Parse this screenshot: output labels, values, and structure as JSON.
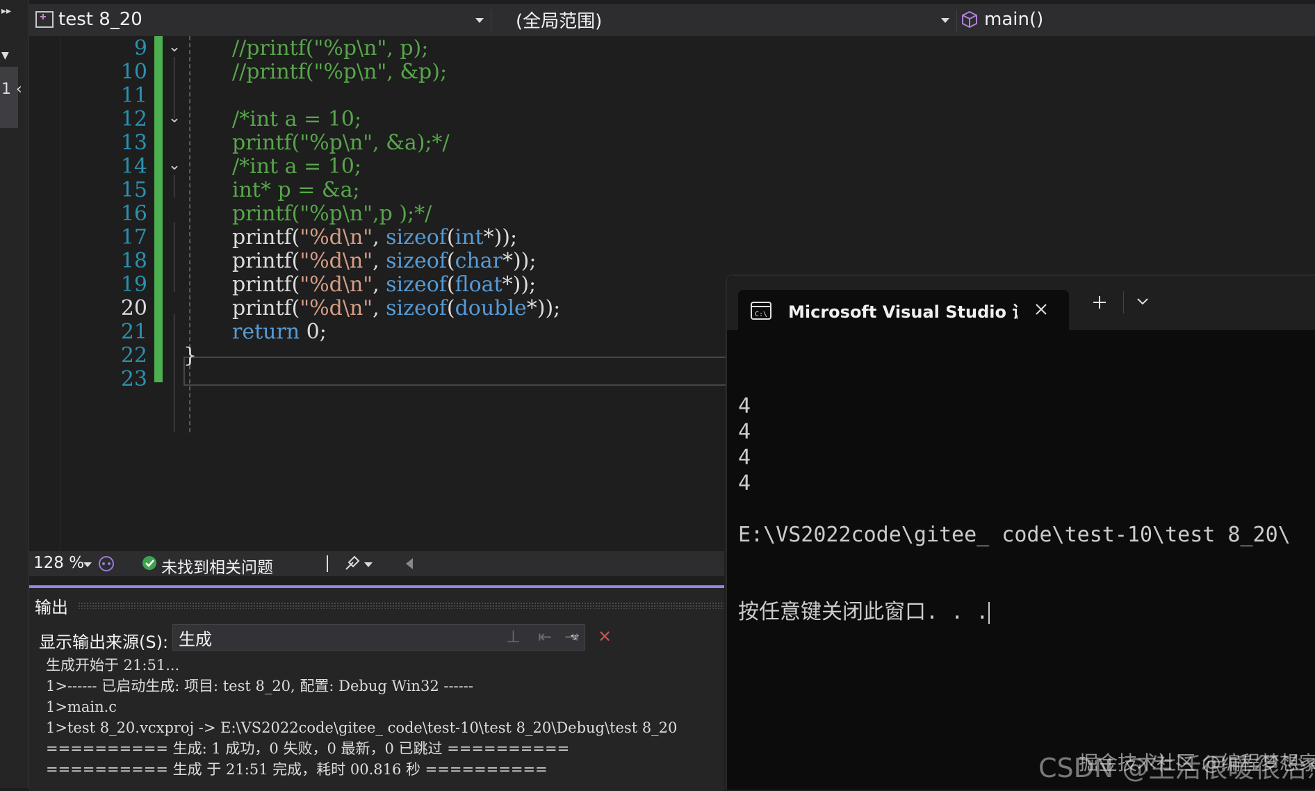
{
  "navbar": {
    "project": "test 8_20",
    "scope": "(全局范围)",
    "member": "main()"
  },
  "left_strip": {
    "glyph1": "▸▸",
    "glyph2": "▼",
    "glyph3": "1 ‹"
  },
  "editor": {
    "lines": [
      {
        "num": "9",
        "tokens": [
          {
            "t": "cm",
            "v": "//printf(\"%p\\n\", p);"
          }
        ]
      },
      {
        "num": "10",
        "tokens": [
          {
            "t": "cm",
            "v": "//printf(\"%p\\n\", &p);"
          }
        ]
      },
      {
        "num": "11",
        "tokens": []
      },
      {
        "num": "12",
        "tokens": [
          {
            "t": "cm",
            "v": "/*int a = 10;"
          }
        ]
      },
      {
        "num": "13",
        "tokens": [
          {
            "t": "cm",
            "v": "printf(\"%p\\n\", &a);*/"
          }
        ]
      },
      {
        "num": "14",
        "tokens": [
          {
            "t": "cm",
            "v": "/*int a = 10;"
          }
        ]
      },
      {
        "num": "15",
        "tokens": [
          {
            "t": "cm",
            "v": "int* p = &a;"
          }
        ]
      },
      {
        "num": "16",
        "tokens": [
          {
            "t": "cm",
            "v": "printf(\"%p\\n\",p );*/"
          }
        ]
      },
      {
        "num": "17",
        "tokens": [
          {
            "t": "tx",
            "v": "printf("
          },
          {
            "t": "str",
            "v": "\"%d\\n\""
          },
          {
            "t": "tx",
            "v": ", "
          },
          {
            "t": "kw",
            "v": "sizeof"
          },
          {
            "t": "tx",
            "v": "("
          },
          {
            "t": "kw",
            "v": "int"
          },
          {
            "t": "tx",
            "v": "*));"
          }
        ]
      },
      {
        "num": "18",
        "tokens": [
          {
            "t": "tx",
            "v": "printf("
          },
          {
            "t": "str",
            "v": "\"%d\\n\""
          },
          {
            "t": "tx",
            "v": ", "
          },
          {
            "t": "kw",
            "v": "sizeof"
          },
          {
            "t": "tx",
            "v": "("
          },
          {
            "t": "kw",
            "v": "char"
          },
          {
            "t": "tx",
            "v": "*));"
          }
        ]
      },
      {
        "num": "19",
        "tokens": [
          {
            "t": "tx",
            "v": "printf("
          },
          {
            "t": "str",
            "v": "\"%d\\n\""
          },
          {
            "t": "tx",
            "v": ", "
          },
          {
            "t": "kw",
            "v": "sizeof"
          },
          {
            "t": "tx",
            "v": "("
          },
          {
            "t": "kw",
            "v": "float"
          },
          {
            "t": "tx",
            "v": "*));"
          }
        ]
      },
      {
        "num": "20",
        "tokens": [
          {
            "t": "tx",
            "v": "printf("
          },
          {
            "t": "str",
            "v": "\"%d\\n\""
          },
          {
            "t": "tx",
            "v": ", "
          },
          {
            "t": "kw",
            "v": "sizeof"
          },
          {
            "t": "tx",
            "v": "("
          },
          {
            "t": "kw",
            "v": "double"
          },
          {
            "t": "tx",
            "v": "*));"
          }
        ]
      },
      {
        "num": "21",
        "tokens": [
          {
            "t": "kw",
            "v": "return"
          },
          {
            "t": "tx",
            "v": " 0;"
          }
        ]
      },
      {
        "num": "22",
        "tokens": [
          {
            "t": "tx",
            "v": "}"
          }
        ]
      },
      {
        "num": "23",
        "tokens": []
      }
    ],
    "current_line": "20"
  },
  "status": {
    "zoom": "128 %",
    "issues": "未找到相关问题"
  },
  "output": {
    "title": "输出",
    "source_label": "显示输出来源(S):",
    "source_value": "生成",
    "lines": [
      "生成开始于 21:51...",
      "1>------ 已启动生成: 项目: test 8_20, 配置: Debug Win32 ------",
      "1>main.c",
      "1>test 8_20.vcxproj -> E:\\VS2022code\\gitee_ code\\test-10\\test 8_20\\Debug\\test 8_20",
      "========== 生成: 1 成功，0 失败，0 最新，0 已跳过 ==========",
      "========== 生成 于 21:51 完成，耗时 00.816 秒 =========="
    ]
  },
  "terminal": {
    "tab_title": "Microsoft Visual Studio 调试控",
    "icon_label": "C:\\",
    "output_lines": [
      "4",
      "4",
      "4",
      "4",
      "",
      "E:\\VS2022code\\gitee_ code\\test-10\\test 8_20\\"
    ],
    "prompt_line": "按任意键关闭此窗口. . ."
  },
  "watermark": {
    "csdn": "CSDN @生活很暖很治愈",
    "juejin": "掘金技术社区 @编程梦想家"
  }
}
